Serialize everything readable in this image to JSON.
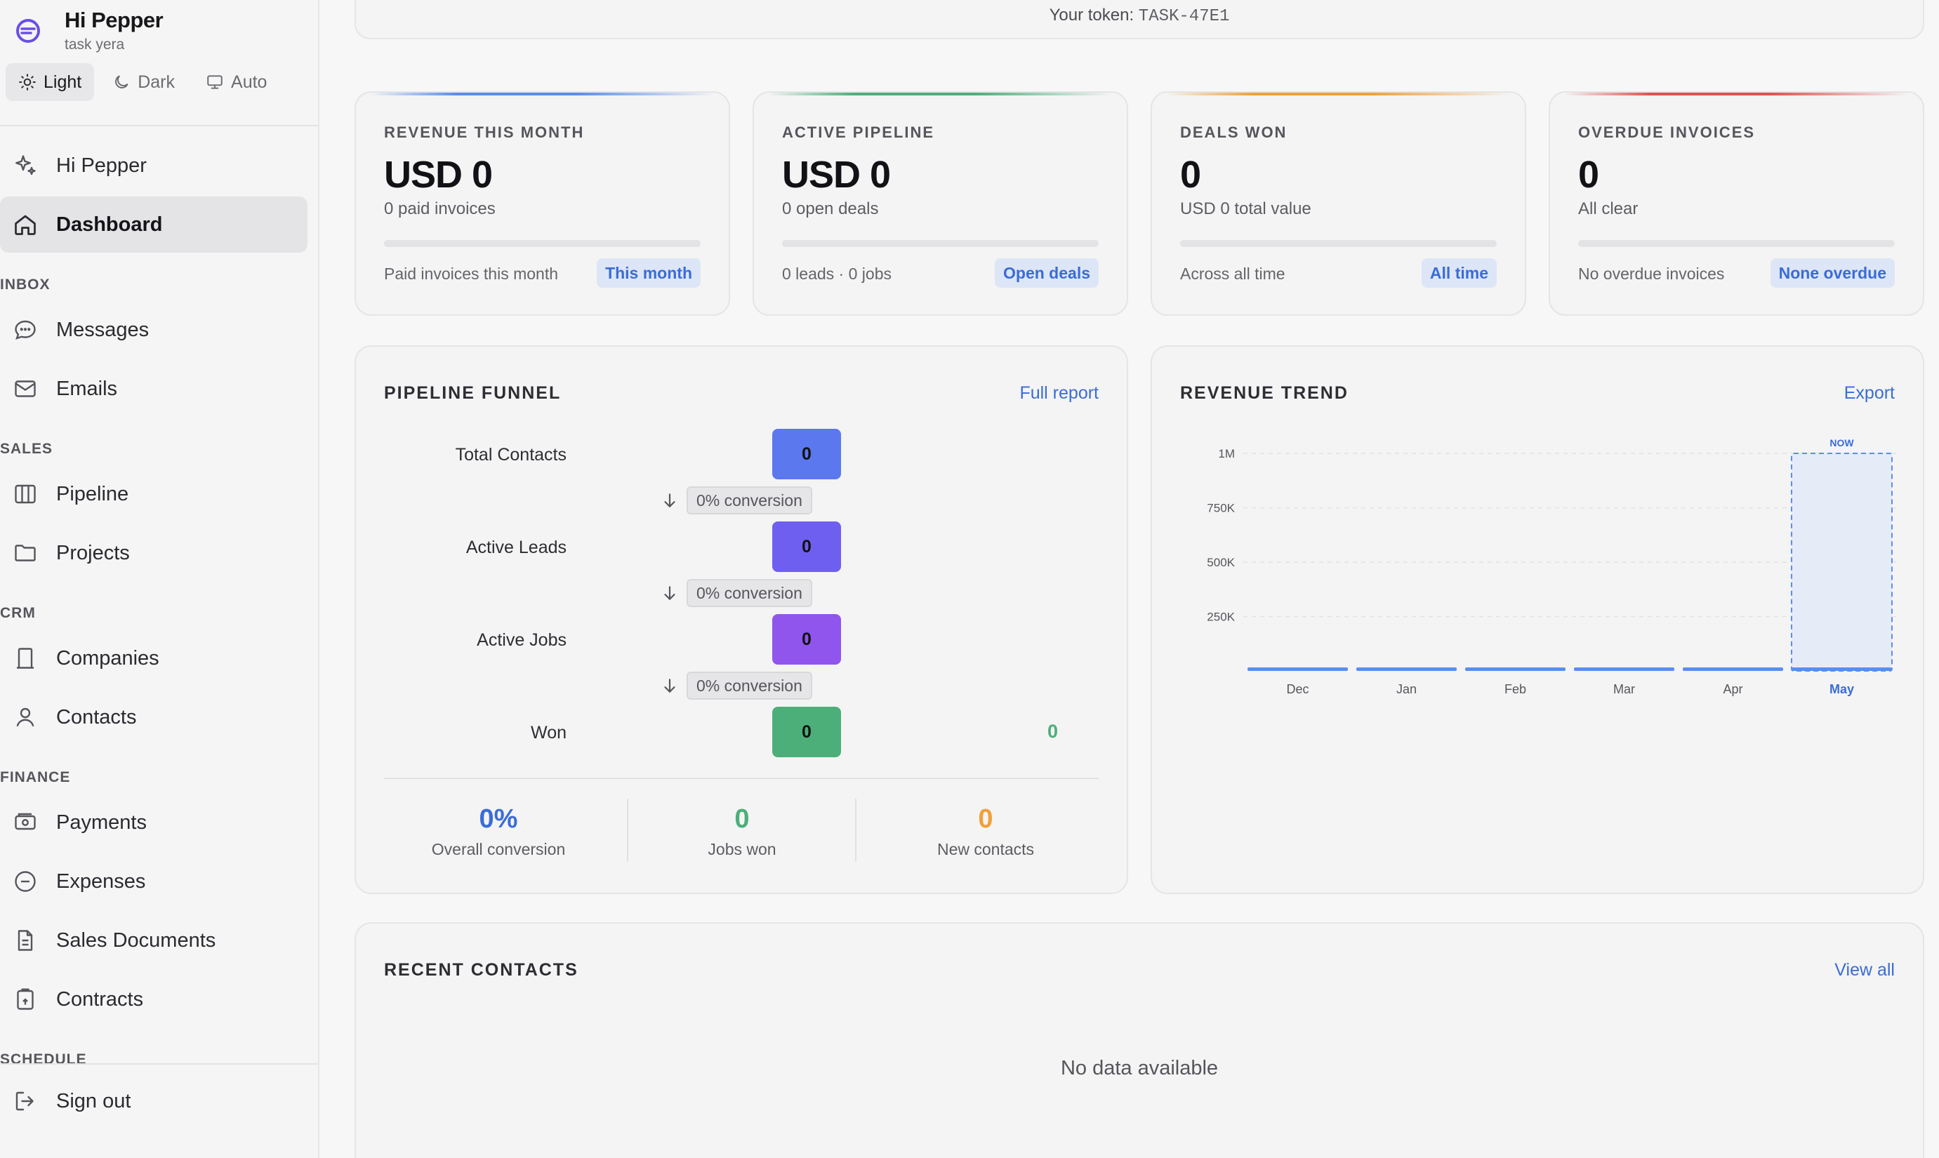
{
  "brand": {
    "name": "Hi Pepper",
    "subtitle": "task yera",
    "logo_icon": "pepper-logo-icon",
    "accent": "#5b4ee0"
  },
  "theme": {
    "light": "Light",
    "dark": "Dark",
    "auto": "Auto",
    "selected": "Light"
  },
  "nav": {
    "items": [
      {
        "label": "Hi Pepper",
        "icon": "sparkles-icon"
      },
      {
        "label": "Dashboard",
        "icon": "home-icon",
        "active": true
      }
    ],
    "sections": {
      "inbox": "INBOX",
      "sales": "SALES",
      "crm": "CRM",
      "finance": "FINANCE",
      "schedule": "SCHEDULE"
    },
    "inbox": [
      {
        "label": "Messages",
        "icon": "chat-bubble-icon"
      },
      {
        "label": "Emails",
        "icon": "mail-icon"
      }
    ],
    "sales": [
      {
        "label": "Pipeline",
        "icon": "columns-icon"
      },
      {
        "label": "Projects",
        "icon": "folder-icon"
      }
    ],
    "crm": [
      {
        "label": "Companies",
        "icon": "building-icon"
      },
      {
        "label": "Contacts",
        "icon": "user-icon"
      }
    ],
    "finance": [
      {
        "label": "Payments",
        "icon": "banknote-icon"
      },
      {
        "label": "Expenses",
        "icon": "minus-circle-icon"
      },
      {
        "label": "Sales Documents",
        "icon": "document-icon"
      },
      {
        "label": "Contracts",
        "icon": "clipboard-icon"
      }
    ],
    "sign_out": {
      "label": "Sign out",
      "icon": "sign-out-icon"
    }
  },
  "token": {
    "prefix": "Your token:",
    "value": "TASK-47E1"
  },
  "stats": [
    {
      "label": "REVENUE THIS MONTH",
      "value": "USD 0",
      "sub": "0 paid invoices",
      "foot": "Paid invoices this month",
      "badge": "This month",
      "accent": "#5b8def",
      "progress": 0
    },
    {
      "label": "ACTIVE PIPELINE",
      "value": "USD 0",
      "sub": "0 open deals",
      "foot": "0 leads · 0 jobs",
      "badge": "Open deals",
      "accent": "#4caf7a",
      "progress": 0
    },
    {
      "label": "DEALS WON",
      "value": "0",
      "sub": "USD 0 total value",
      "foot": "Across all time",
      "badge": "All time",
      "accent": "#f0a13a",
      "progress": 0
    },
    {
      "label": "OVERDUE INVOICES",
      "value": "0",
      "sub": "All clear",
      "foot": "No overdue invoices",
      "badge": "None overdue",
      "accent": "#e0524f",
      "progress": 0
    }
  ],
  "funnel": {
    "title": "PIPELINE FUNNEL",
    "link": "Full report",
    "stages": [
      {
        "label": "Total Contacts",
        "value": "0",
        "color": "#5b78ee"
      },
      {
        "label": "Active Leads",
        "value": "0",
        "color": "#6f5ff0"
      },
      {
        "label": "Active Jobs",
        "value": "0",
        "color": "#9055ec"
      },
      {
        "label": "Won",
        "value": "0",
        "color": "#4caf7a",
        "side_value": "0"
      }
    ],
    "conversions": [
      "0% conversion",
      "0% conversion",
      "0% conversion"
    ],
    "summary": [
      {
        "value": "0%",
        "label": "Overall conversion",
        "color": "#3a6cd6"
      },
      {
        "value": "0",
        "label": "Jobs won",
        "color": "#4caf7a"
      },
      {
        "value": "0",
        "label": "New contacts",
        "color": "#f0a13a"
      }
    ]
  },
  "revenue": {
    "title": "REVENUE TREND",
    "link": "Export",
    "now_label": "NOW"
  },
  "chart_data": {
    "type": "bar",
    "categories": [
      "Dec",
      "Jan",
      "Feb",
      "Mar",
      "Apr",
      "May"
    ],
    "values": [
      0,
      0,
      0,
      0,
      0,
      0
    ],
    "ylim": [
      0,
      1000000
    ],
    "yticks": [
      "250K",
      "500K",
      "750K",
      "1M"
    ],
    "ytick_values": [
      250000,
      500000,
      750000,
      1000000
    ],
    "highlight_category": "May",
    "grid": true,
    "xlabel": "",
    "ylabel": "",
    "bar_color": "#5b8def"
  },
  "recent": {
    "title": "RECENT CONTACTS",
    "link": "View all",
    "empty": "No data available"
  }
}
